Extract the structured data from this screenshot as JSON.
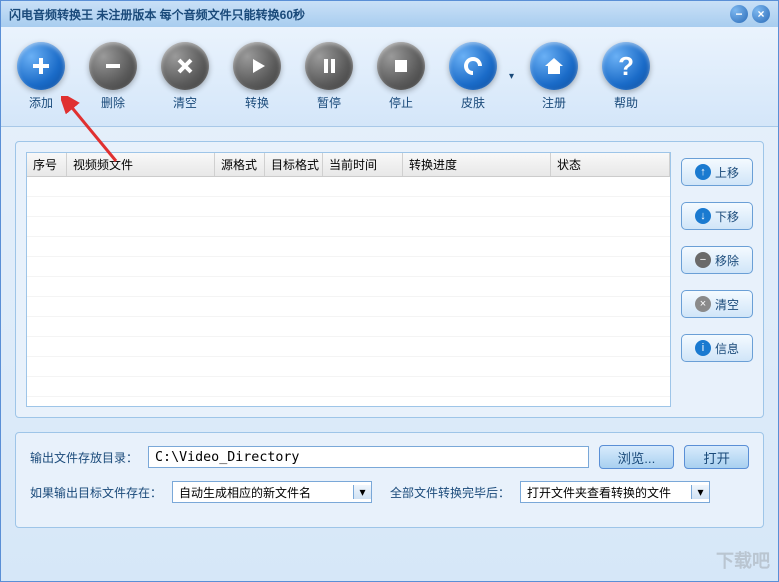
{
  "titlebar": {
    "title": "闪电音频转换王  未注册版本 每个音频文件只能转换60秒"
  },
  "toolbar": {
    "add": "添加",
    "delete": "删除",
    "clear": "清空",
    "convert": "转换",
    "pause": "暂停",
    "stop": "停止",
    "skin": "皮肤",
    "register": "注册",
    "help": "帮助"
  },
  "table": {
    "cols": {
      "seq": "序号",
      "file": "视频频文件",
      "srcfmt": "源格式",
      "tgtfmt": "目标格式",
      "curtime": "当前时间",
      "progress": "转换进度",
      "status": "状态"
    }
  },
  "sidebuttons": {
    "up": "上移",
    "down": "下移",
    "remove": "移除",
    "clear": "清空",
    "info": "信息"
  },
  "bottom": {
    "outdir_label": "输出文件存放目录：",
    "outdir_value": "C:\\Video_Directory",
    "browse": "浏览...",
    "open": "打开",
    "ifexist_label": "如果输出目标文件存在：",
    "ifexist_value": "自动生成相应的新文件名",
    "afterall_label": "全部文件转换完毕后：",
    "afterall_value": "打开文件夹查看转换的文件"
  },
  "watermark": "下载吧"
}
